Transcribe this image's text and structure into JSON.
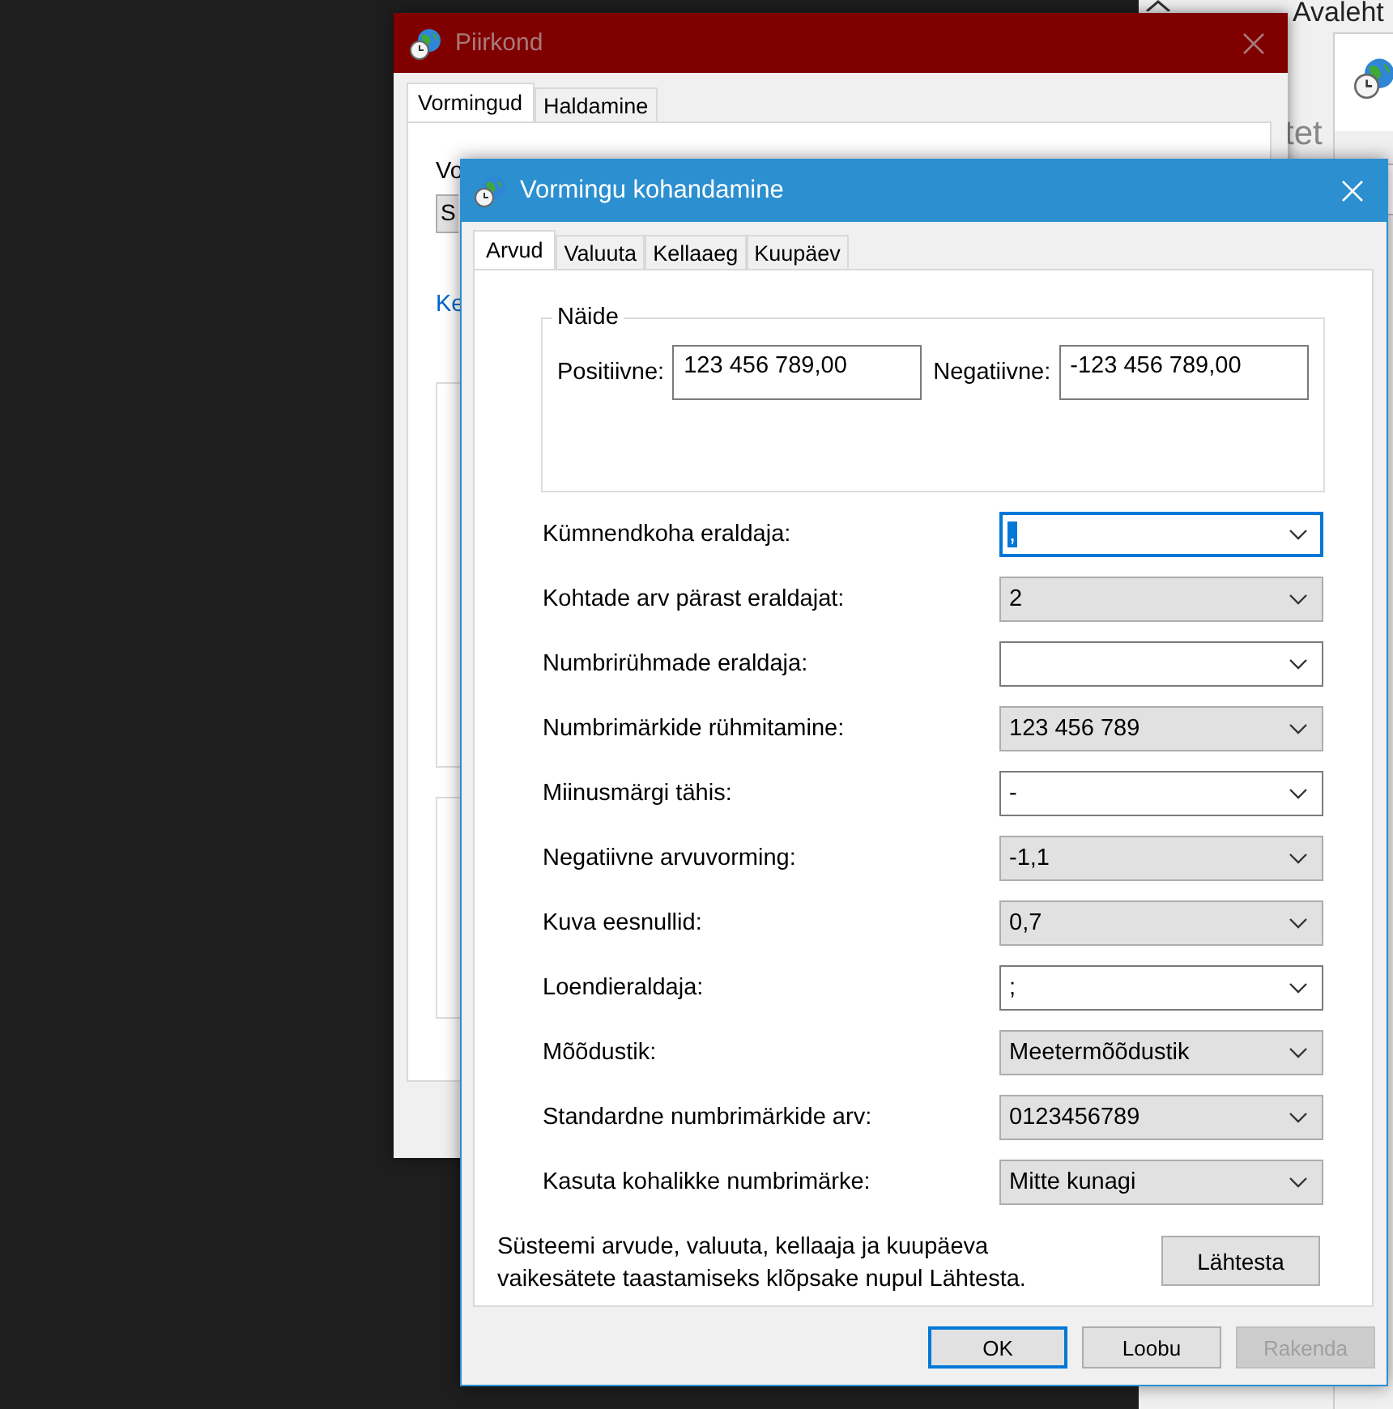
{
  "settings_window": {
    "heading": "Avaleht",
    "fragment": "tet"
  },
  "region_window": {
    "title": "Piirkond",
    "active": false,
    "tabs": [
      {
        "label": "Vormingud",
        "selected": true
      },
      {
        "label": "Haldamine",
        "selected": false
      }
    ],
    "format_label": "Vo",
    "format_combo": "S",
    "link": "Ke"
  },
  "dialog": {
    "title": "Vormingu kohandamine",
    "active": true,
    "tabs": [
      {
        "label": "Arvud",
        "selected": true
      },
      {
        "label": "Valuuta",
        "selected": false
      },
      {
        "label": "Kellaaeg",
        "selected": false
      },
      {
        "label": "Kuupäev",
        "selected": false
      }
    ],
    "sample": {
      "legend": "Näide",
      "positive_label": "Positiivne:",
      "positive_value": "123 456 789,00",
      "negative_label": "Negatiivne:",
      "negative_value": "-123 456 789,00"
    },
    "settings": [
      {
        "label": "Kümnendkoha eraldaja:",
        "value": ",",
        "kind": "editable",
        "focused": true
      },
      {
        "label": "Kohtade arv pärast eraldajat:",
        "value": "2",
        "kind": "list",
        "focused": false
      },
      {
        "label": "Numbrirühmade eraldaja:",
        "kind": "editable",
        "focused": false
      },
      {
        "label": "Numbrimärkide rühmitamine:",
        "value": "123 456 789",
        "kind": "list",
        "focused": false
      },
      {
        "label": "Miinusmärgi tähis:",
        "value": "-",
        "kind": "editable",
        "focused": false
      },
      {
        "label": "Negatiivne arvuvorming:",
        "value": "-1,1",
        "kind": "list",
        "focused": false
      },
      {
        "label": "Kuva eesnullid:",
        "value": "0,7",
        "kind": "list",
        "focused": false
      },
      {
        "label": "Loendieraldaja:",
        "value": ";",
        "kind": "editable",
        "focused": false
      },
      {
        "label": "Mõõdustik:",
        "value": "Meetermõõdustik",
        "kind": "list",
        "focused": false
      },
      {
        "label": "Standardne numbrimärkide arv:",
        "value": "0123456789",
        "kind": "list",
        "focused": false
      },
      {
        "label": "Kasuta kohalikke numbrimärke:",
        "value": "Mitte kunagi",
        "kind": "list",
        "focused": false
      }
    ],
    "reset_note": "Süsteemi arvude, valuuta, kellaaja ja kuupäeva vaikesätete taastamiseks klõpsake nupul Lähtesta.",
    "reset_button": "Lähtesta",
    "buttons": [
      {
        "label": "OK",
        "default": true,
        "disabled": false
      },
      {
        "label": "Loobu",
        "default": false,
        "disabled": false
      },
      {
        "label": "Rakenda",
        "default": false,
        "disabled": true
      }
    ]
  }
}
